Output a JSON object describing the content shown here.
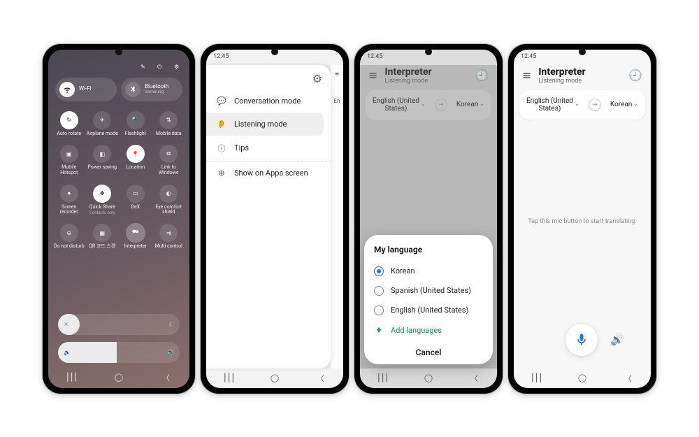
{
  "statusbar_time": "12:45",
  "p1": {
    "wifi": {
      "label": "Wi-Fi",
      "sub": ""
    },
    "bt": {
      "label": "Bluetooth",
      "sub": "Samsung"
    },
    "tiles": [
      {
        "name": "auto-rotate",
        "label": "Auto rotate",
        "on": true,
        "icon": "↻"
      },
      {
        "name": "airplane",
        "label": "Airplane mode",
        "on": false,
        "icon": "✈"
      },
      {
        "name": "flashlight",
        "label": "Flashlight",
        "on": false,
        "icon": "🔦"
      },
      {
        "name": "mobile-data",
        "label": "Mobile data",
        "on": false,
        "icon": "⇅"
      },
      {
        "name": "hotspot",
        "label": "Mobile Hotspot",
        "on": false,
        "icon": "▣"
      },
      {
        "name": "power-saving",
        "label": "Power saving",
        "on": false,
        "icon": "◧"
      },
      {
        "name": "location",
        "label": "Location",
        "on": true,
        "icon": "📍"
      },
      {
        "name": "link-windows",
        "label": "Link to Windows",
        "on": false,
        "icon": "⧉"
      },
      {
        "name": "screen-rec",
        "label": "Screen recorder",
        "on": false,
        "icon": "⏺"
      },
      {
        "name": "quick-share",
        "label": "Quick Share",
        "sub": "Contacts only",
        "on": true,
        "icon": "❖"
      },
      {
        "name": "dex",
        "label": "DeX",
        "on": false,
        "icon": "▭"
      },
      {
        "name": "eye-comfort",
        "label": "Eye comfort shield",
        "on": false,
        "icon": "◐"
      },
      {
        "name": "dnd",
        "label": "Do not disturb",
        "on": false,
        "icon": "⊝"
      },
      {
        "name": "qr",
        "label": "QR 코드 스캔",
        "on": false,
        "icon": "▦"
      },
      {
        "name": "interpreter",
        "label": "Interpreter",
        "on": false,
        "icon": "🗪",
        "sel": true
      },
      {
        "name": "multi-control",
        "label": "Multi control",
        "on": false,
        "icon": "⇉"
      }
    ]
  },
  "p2": {
    "items": [
      {
        "icon": "💬",
        "label": "Conversation mode",
        "active": false
      },
      {
        "icon": "👂",
        "label": "Listening mode",
        "active": true
      },
      {
        "icon": "ⓘ",
        "label": "Tips",
        "active": false,
        "br": true
      },
      {
        "icon": "⊕",
        "label": "Show on Apps screen",
        "active": false
      }
    ],
    "edge_label": "En"
  },
  "interp": {
    "title": "Interpreter",
    "subtitle": "Listening mode",
    "from": "English (United\nStates)",
    "to": "Korean"
  },
  "sheet": {
    "title": "My language",
    "opts": [
      {
        "label": "Korean",
        "checked": true
      },
      {
        "label": "Spanish (United States)",
        "checked": false
      },
      {
        "label": "English (United States)",
        "checked": false
      }
    ],
    "add": "Add languages",
    "cancel": "Cancel"
  },
  "p4": {
    "hint": "Tap this mic button to start translating."
  }
}
